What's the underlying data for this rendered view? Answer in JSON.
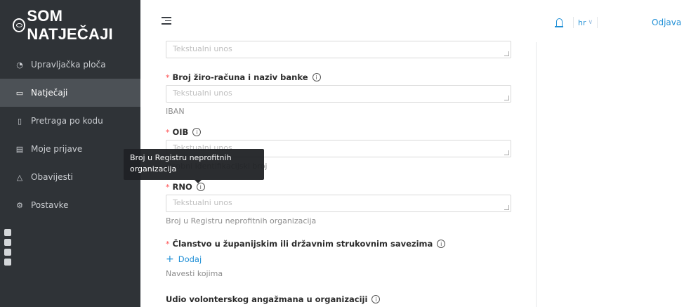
{
  "brand": {
    "name": "SOM NATJEČAJI"
  },
  "sidebar": {
    "items": [
      {
        "label": "Upravljačka ploča",
        "icon": "dashboard-icon",
        "active": false
      },
      {
        "label": "Natječaji",
        "icon": "folder-icon",
        "active": true
      },
      {
        "label": "Pretraga po kodu",
        "icon": "file-icon",
        "active": false
      },
      {
        "label": "Moje prijave",
        "icon": "file-text-icon",
        "active": false
      },
      {
        "label": "Obavijesti",
        "icon": "bell-icon",
        "active": false
      },
      {
        "label": "Postavke",
        "icon": "gear-icon",
        "active": false
      }
    ]
  },
  "header": {
    "language": "hr",
    "logout_label": "Odjava"
  },
  "form": {
    "fields": [
      {
        "label": "",
        "required": false,
        "placeholder": "Tekstualni unos",
        "help": ""
      },
      {
        "label": "Broj žiro-računa i naziv banke",
        "required": true,
        "placeholder": "Tekstualni unos",
        "help": "IBAN"
      },
      {
        "label": "OIB",
        "required": true,
        "placeholder": "Tekstualni unos",
        "help": "Osobni identifikacijski broj"
      },
      {
        "label": "RNO",
        "required": true,
        "placeholder": "Tekstualni unos",
        "help": "Broj u Registru neprofitnih organizacija"
      },
      {
        "label": "Članstvo u županijskim ili državnim strukovnim savezima",
        "required": true,
        "add_label": "Dodaj",
        "help": "Navesti kojima"
      },
      {
        "label": "Udio volonterskog angažmana u organizaciji",
        "required": false
      }
    ]
  },
  "tooltip": {
    "text": "Broj u Registru neprofitnih organizacija"
  },
  "colors": {
    "accent": "#1f8fd6",
    "sidebar": "#2f3337",
    "required": "#ff4d4f"
  }
}
